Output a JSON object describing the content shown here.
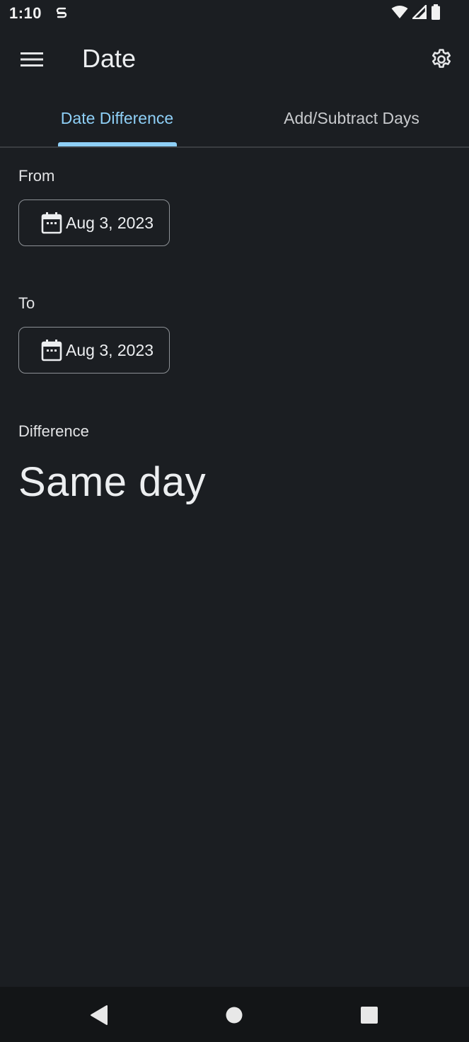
{
  "status_bar": {
    "time": "1:10",
    "icons": [
      "sync-s-icon",
      "wifi-icon",
      "signal-icon",
      "battery-icon"
    ]
  },
  "app_bar": {
    "title": "Date",
    "menu_icon": "hamburger-menu-icon",
    "settings_icon": "gear-icon"
  },
  "tabs": [
    {
      "label": "Date Difference",
      "selected": true
    },
    {
      "label": "Add/Subtract Days",
      "selected": false
    }
  ],
  "from": {
    "label": "From",
    "date": "Aug 3, 2023"
  },
  "to": {
    "label": "To",
    "date": "Aug 3, 2023"
  },
  "difference": {
    "label": "Difference",
    "value": "Same day"
  },
  "colors": {
    "background": "#1b1e22",
    "accent": "#8ecff6",
    "nav_bar": "#131517"
  },
  "nav_bar": {
    "icons": [
      "back-icon",
      "home-icon",
      "recents-icon"
    ]
  }
}
